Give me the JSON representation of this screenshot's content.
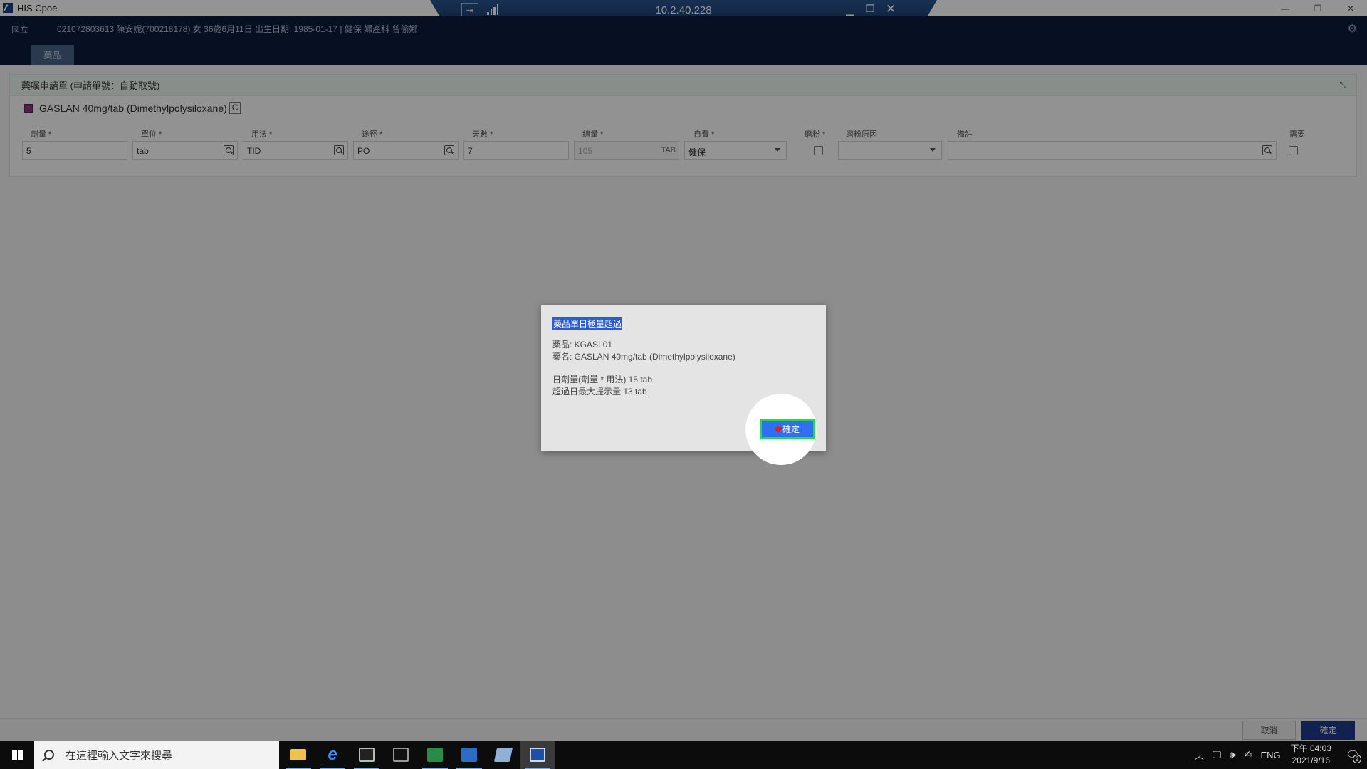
{
  "window": {
    "title": "HIS Cpoe",
    "controls": [
      "minimize",
      "restore",
      "close"
    ]
  },
  "remote_bar": {
    "ip": "10.2.40.228"
  },
  "header": {
    "hospital": "國立",
    "patient_info": "021072803613 陳安妮(700218178) 女 36歲6月11日 出生日期: 1985-01-17 | 健保 婦產科 曾偷娜",
    "tab_drug": "藥品"
  },
  "card": {
    "title": "藥嘱申請單 (申請單號：自動取號)",
    "drug_name": "GASLAN 40mg/tab (Dimethylpolysiloxane)",
    "drug_code_tag": "C",
    "fields": {
      "dose": {
        "label": "劑量 *",
        "value": "5"
      },
      "unit": {
        "label": "單位 *",
        "value": "tab"
      },
      "frequency": {
        "label": "用法 *",
        "value": "TID"
      },
      "route": {
        "label": "途徑 *",
        "value": "PO"
      },
      "days": {
        "label": "天數 *",
        "value": "7"
      },
      "total": {
        "label": "總量 *",
        "value": "105",
        "unit": "TAB"
      },
      "payment": {
        "label": "自費 *",
        "value": "健保"
      },
      "grind": {
        "label": "磨粉 *"
      },
      "grind_reason": {
        "label": "磨粉原因",
        "value": ""
      },
      "remark": {
        "label": "備註",
        "value": ""
      },
      "prn": {
        "label": "需要"
      }
    }
  },
  "dialog": {
    "title": "藥品單日極量超過",
    "line_code": "藥品: KGASL01",
    "line_name": "藥名: GASLAN 40mg/tab (Dimethylpolysiloxane)",
    "line_daily": "日劑量(劑量 * 用法) 15 tab",
    "line_max": "超過日最大提示量 13 tab",
    "ok_button": "確定"
  },
  "bottom_bar": {
    "cancel": "取消",
    "confirm": "確定"
  },
  "taskbar": {
    "search_placeholder": "在這裡輸入文字來搜尋",
    "tray": {
      "language": "ENG",
      "time": "下午 04:03",
      "date": "2021/9/16",
      "notification_count": "2"
    }
  },
  "colors": {
    "header_bg": "#0d1b3d",
    "accent_blue": "#2f6ff2",
    "focus_green": "#22d84c",
    "confirm_bg": "#1e3a8a"
  }
}
